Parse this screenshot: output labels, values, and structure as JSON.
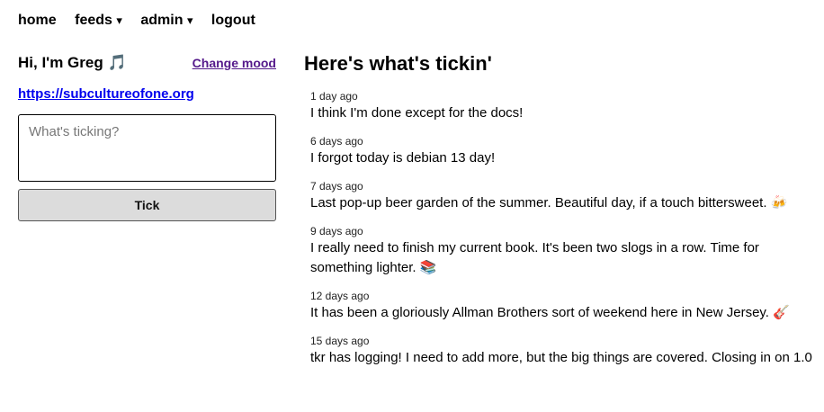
{
  "nav": {
    "home": "home",
    "feeds": "feeds",
    "admin": "admin",
    "logout": "logout",
    "caret": "▾"
  },
  "profile": {
    "greeting": "Hi, I'm Greg 🎵",
    "change_mood": "Change mood",
    "url": "https://subcultureofone.org"
  },
  "composer": {
    "placeholder": "What's ticking?",
    "value": "",
    "button_label": "Tick"
  },
  "feed": {
    "title": "Here's what's tickin'",
    "ticks": [
      {
        "time": "1 day ago",
        "text": "I think I'm done except for the docs!"
      },
      {
        "time": "6 days ago",
        "text": "I forgot today is debian 13 day!"
      },
      {
        "time": "7 days ago",
        "text": "Last pop-up beer garden of the summer. Beautiful day, if a touch bittersweet. 🍻"
      },
      {
        "time": "9 days ago",
        "text": "I really need to finish my current book. It's been two slogs in a row. Time for something lighter. 📚"
      },
      {
        "time": "12 days ago",
        "text": "It has been a gloriously Allman Brothers sort of weekend here in New Jersey. 🎸"
      },
      {
        "time": "15 days ago",
        "text": "tkr has logging! I need to add more, but the big things are covered. Closing in on 1.0"
      }
    ]
  }
}
